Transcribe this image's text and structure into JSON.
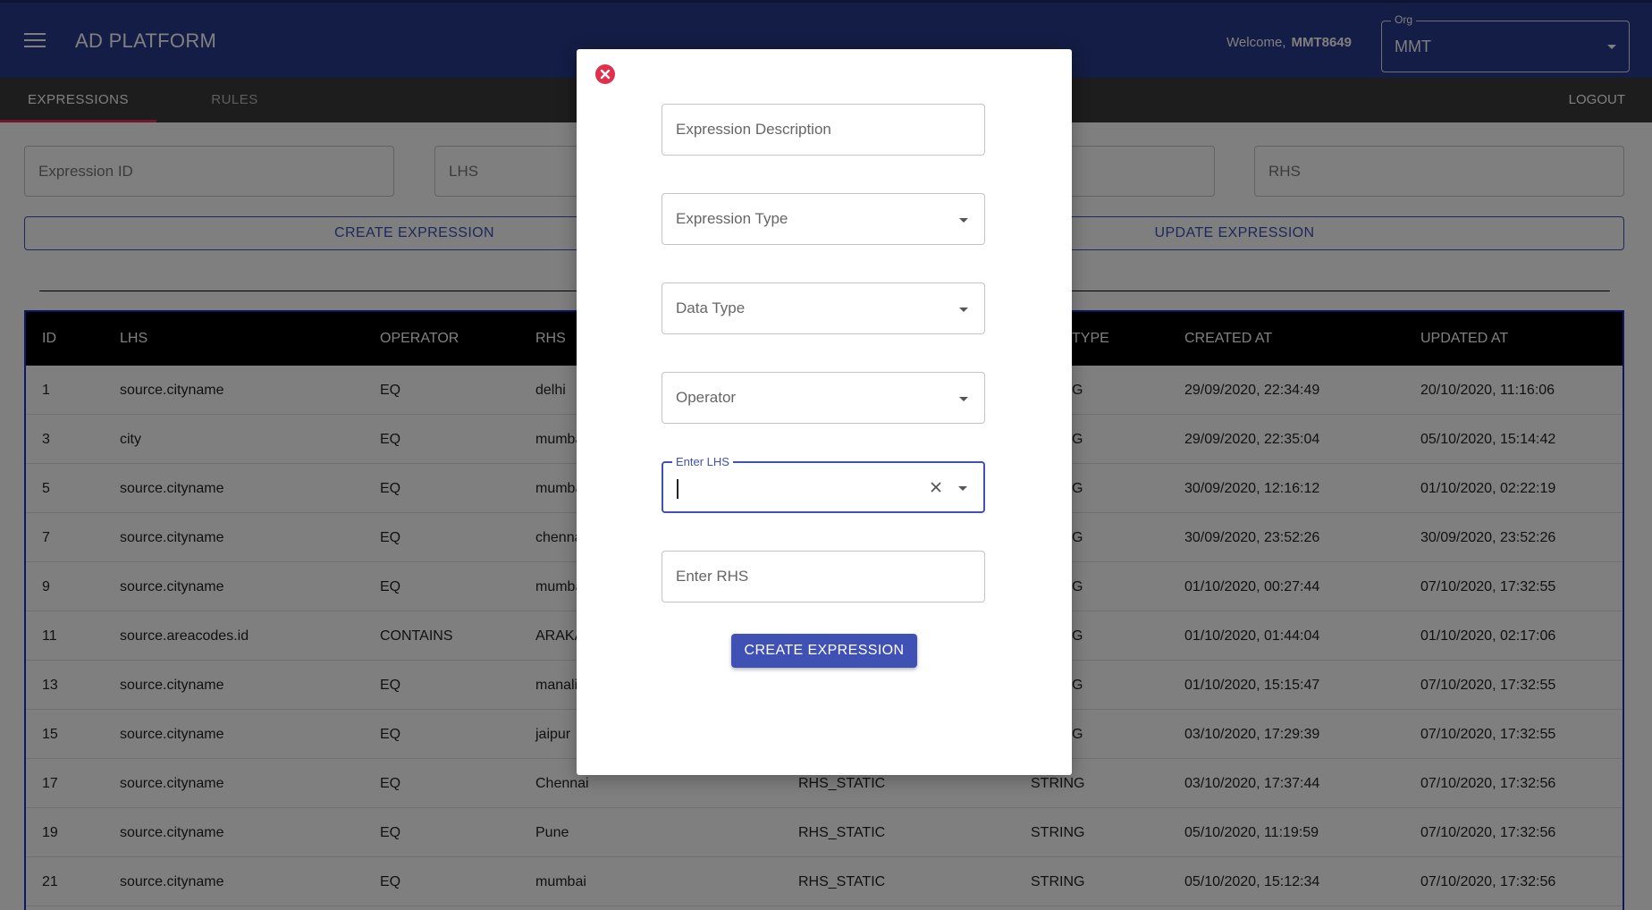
{
  "app": {
    "title": "AD PLATFORM",
    "welcome_label": "Welcome,",
    "username": "MMT8649",
    "org": {
      "label": "Org",
      "value": "MMT"
    }
  },
  "tabs": [
    {
      "label": "EXPRESSIONS",
      "active": true
    },
    {
      "label": "RULES",
      "active": false
    }
  ],
  "logout_label": "LOGOUT",
  "filters": {
    "expression_id": "Expression ID",
    "lhs": "LHS",
    "rhs": "RHS"
  },
  "buttons": {
    "create_expression": "CREATE EXPRESSION",
    "update_expression": "UPDATE EXPRESSION"
  },
  "table": {
    "headers": [
      "ID",
      "LHS",
      "OPERATOR",
      "RHS",
      "TYPE",
      "CREATED AT",
      "UPDATED AT"
    ],
    "rows": [
      [
        "1",
        "source.cityname",
        "EQ",
        "delhi",
        "G",
        "29/09/2020, 22:34:49",
        "20/10/2020, 11:16:06"
      ],
      [
        "3",
        "city",
        "EQ",
        "mumba",
        "G",
        "29/09/2020, 22:35:04",
        "05/10/2020, 15:14:42"
      ],
      [
        "5",
        "source.cityname",
        "EQ",
        "mumba",
        "G",
        "30/09/2020, 12:16:12",
        "01/10/2020, 02:22:19"
      ],
      [
        "7",
        "source.cityname",
        "EQ",
        "chenna",
        "G",
        "30/09/2020, 23:52:26",
        "30/09/2020, 23:52:26"
      ],
      [
        "9",
        "source.cityname",
        "EQ",
        "mumba",
        "G",
        "01/10/2020, 00:27:44",
        "07/10/2020, 17:32:55"
      ],
      [
        "11",
        "source.areacodes.id",
        "CONTAINS",
        "ARAKA",
        "G",
        "01/10/2020, 01:44:04",
        "01/10/2020, 02:17:06"
      ],
      [
        "13",
        "source.cityname",
        "EQ",
        "manali",
        "G",
        "01/10/2020, 15:15:47",
        "07/10/2020, 17:32:55"
      ],
      [
        "15",
        "source.cityname",
        "EQ",
        "jaipur",
        "G",
        "03/10/2020, 17:29:39",
        "07/10/2020, 17:32:55"
      ],
      [
        "17",
        "source.cityname",
        "EQ",
        "Chennai",
        "RHS_STATIC",
        "STRING",
        "03/10/2020, 17:37:44",
        "07/10/2020, 17:32:56"
      ],
      [
        "19",
        "source.cityname",
        "EQ",
        "Pune",
        "RHS_STATIC",
        "STRING",
        "05/10/2020, 11:19:59",
        "07/10/2020, 17:32:56"
      ],
      [
        "21",
        "source.cityname",
        "EQ",
        "mumbai",
        "RHS_STATIC",
        "STRING",
        "05/10/2020, 15:12:34",
        "07/10/2020, 17:32:56"
      ]
    ]
  },
  "modal": {
    "fields": {
      "description": "Expression Description",
      "type": "Expression Type",
      "data_type": "Data Type",
      "operator": "Operator",
      "lhs_legend": "Enter LHS",
      "rhs": "Enter RHS"
    },
    "submit_label": "CREATE EXPRESSION"
  },
  "colors": {
    "appbar": "#273a8b",
    "primary": "#3f51b5",
    "accent": "#e0304d"
  }
}
